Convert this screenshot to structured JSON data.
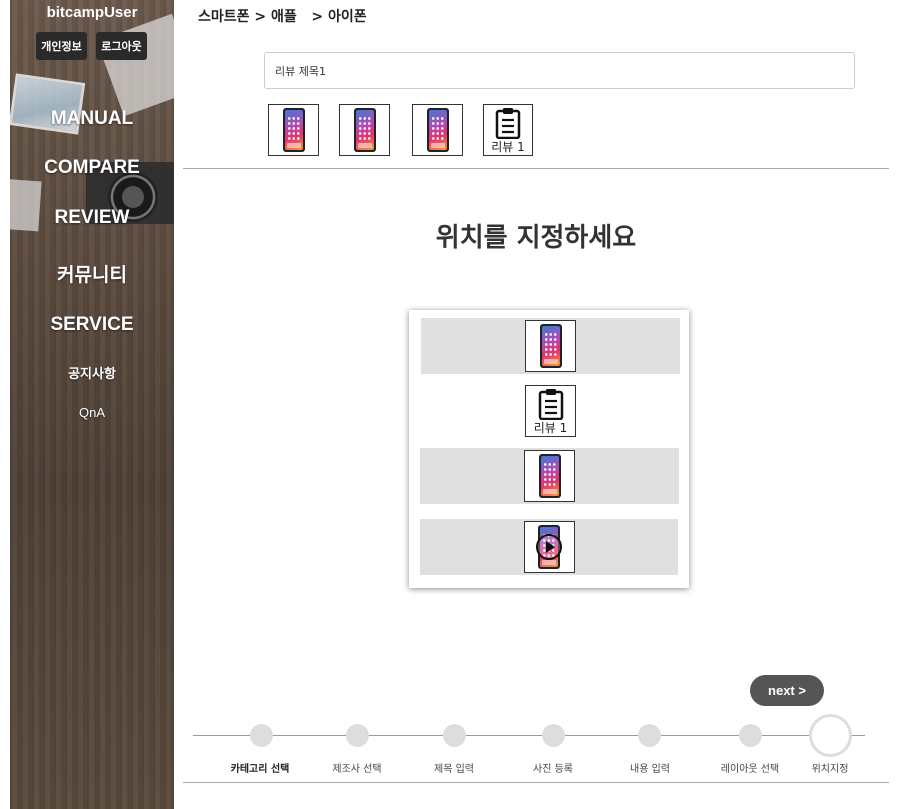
{
  "user": {
    "name": "bitcampUser",
    "info_button": "개인정보",
    "logout_button": "로그아웃"
  },
  "nav": {
    "manual": "MANUAL",
    "compare": "COMPARE",
    "review": "REVIEW",
    "community": "커뮤니티",
    "service": "SERVICE",
    "notice": "공지사항",
    "qna": "QnA"
  },
  "breadcrumb": "스마트폰 > 애플   > 아이폰",
  "review_title": {
    "value": "리뷰 제목1",
    "placeholder": ""
  },
  "thumbnails": [
    {
      "type": "phone-image"
    },
    {
      "type": "phone-image"
    },
    {
      "type": "phone-image"
    },
    {
      "type": "text-review",
      "label": "리뷰 1"
    }
  ],
  "heading": "위치를 지정하세요",
  "layout_slots": [
    {
      "type": "phone-image"
    },
    {
      "type": "text-review",
      "label": "리뷰 1"
    },
    {
      "type": "phone-image"
    },
    {
      "type": "phone-video"
    }
  ],
  "next_button": "next >",
  "steps": [
    {
      "label": "카테고리 선택",
      "active": true
    },
    {
      "label": "제조사 선택",
      "active": false
    },
    {
      "label": "제목 입력",
      "active": false
    },
    {
      "label": "사진 등록",
      "active": false
    },
    {
      "label": "내용 입력",
      "active": false
    },
    {
      "label": "레이아웃 선택",
      "active": false
    },
    {
      "label": "위치지정",
      "active": false,
      "current": true
    }
  ],
  "colors": {
    "sidebar_wood": "#5d4c40",
    "slot_gray": "#e0e0e0",
    "next_button": "#555555",
    "step_dot": "#dddddd"
  }
}
